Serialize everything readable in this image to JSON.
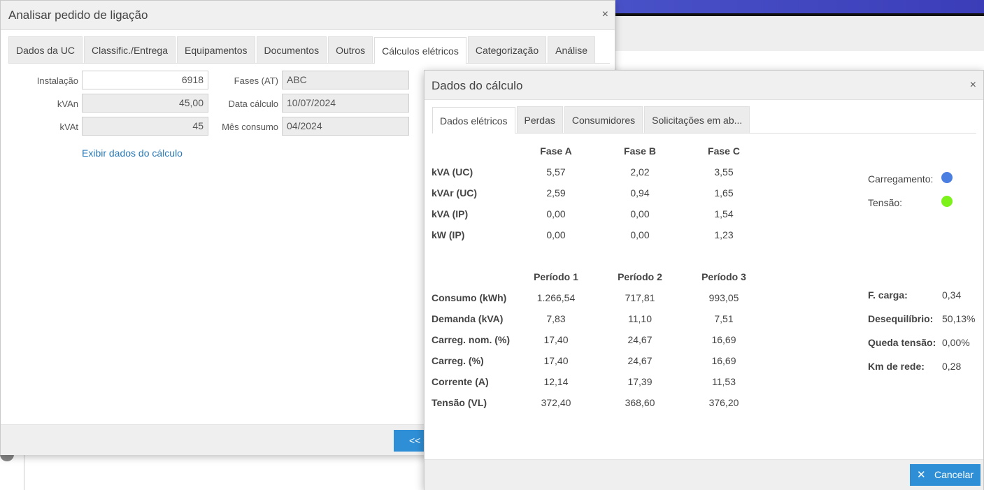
{
  "main_dialog": {
    "title": "Analisar pedido de ligação",
    "close": "×",
    "tabs": [
      "Dados da UC",
      "Classific./Entrega",
      "Equipamentos",
      "Documentos",
      "Outros",
      "Cálculos elétricos",
      "Categorização",
      "Análise"
    ],
    "active_tab": "Cálculos elétricos",
    "fields": {
      "instalacao_label": "Instalação",
      "instalacao_value": "6918",
      "kvan_label": "kVAn",
      "kvan_value": "45,00",
      "kvat_label": "kVAt",
      "kvat_value": "45",
      "fases_label": "Fases (AT)",
      "fases_value": "ABC",
      "data_label": "Data cálculo",
      "data_value": "10/07/2024",
      "mes_label": "Mês consumo",
      "mes_value": "04/2024"
    },
    "link": "Exibir dados do cálculo",
    "back_button": "<<"
  },
  "calc_dialog": {
    "title": "Dados do cálculo",
    "close": "×",
    "tabs": [
      "Dados elétricos",
      "Perdas",
      "Consumidores",
      "Solicitações em ab..."
    ],
    "active_tab": "Dados elétricos",
    "phase_table": {
      "headers": [
        "Fase A",
        "Fase B",
        "Fase C"
      ],
      "rows": [
        {
          "label": "kVA (UC)",
          "values": [
            "5,57",
            "2,02",
            "3,55"
          ]
        },
        {
          "label": "kVAr (UC)",
          "values": [
            "2,59",
            "0,94",
            "1,65"
          ]
        },
        {
          "label": "kVA (IP)",
          "values": [
            "0,00",
            "0,00",
            "1,54"
          ]
        },
        {
          "label": "kW (IP)",
          "values": [
            "0,00",
            "0,00",
            "1,23"
          ]
        }
      ]
    },
    "period_table": {
      "headers": [
        "Período 1",
        "Período 2",
        "Período 3"
      ],
      "rows": [
        {
          "label": "Consumo (kWh)",
          "values": [
            "1.266,54",
            "717,81",
            "993,05"
          ]
        },
        {
          "label": "Demanda (kVA)",
          "values": [
            "7,83",
            "11,10",
            "7,51"
          ]
        },
        {
          "label": "Carreg. nom. (%)",
          "values": [
            "17,40",
            "24,67",
            "16,69"
          ]
        },
        {
          "label": "Carreg. (%)",
          "values": [
            "17,40",
            "24,67",
            "16,69"
          ]
        },
        {
          "label": "Corrente (A)",
          "values": [
            "12,14",
            "17,39",
            "11,53"
          ]
        },
        {
          "label": "Tensão (VL)",
          "values": [
            "372,40",
            "368,60",
            "376,20"
          ]
        }
      ]
    },
    "indicators": {
      "carregamento_label": "Carregamento:",
      "carregamento_color": "#4a7ee0",
      "tensao_label": "Tensão:",
      "tensao_color": "#7cf21a"
    },
    "stats": [
      {
        "label": "F. carga:",
        "value": "0,34"
      },
      {
        "label": "Desequilíbrio:",
        "value": "50,13%"
      },
      {
        "label": "Queda tensão:",
        "value": "0,00%"
      },
      {
        "label": "Km de rede:",
        "value": "0,28"
      }
    ],
    "cancel_button": "Cancelar",
    "cancel_icon": "close-icon"
  }
}
